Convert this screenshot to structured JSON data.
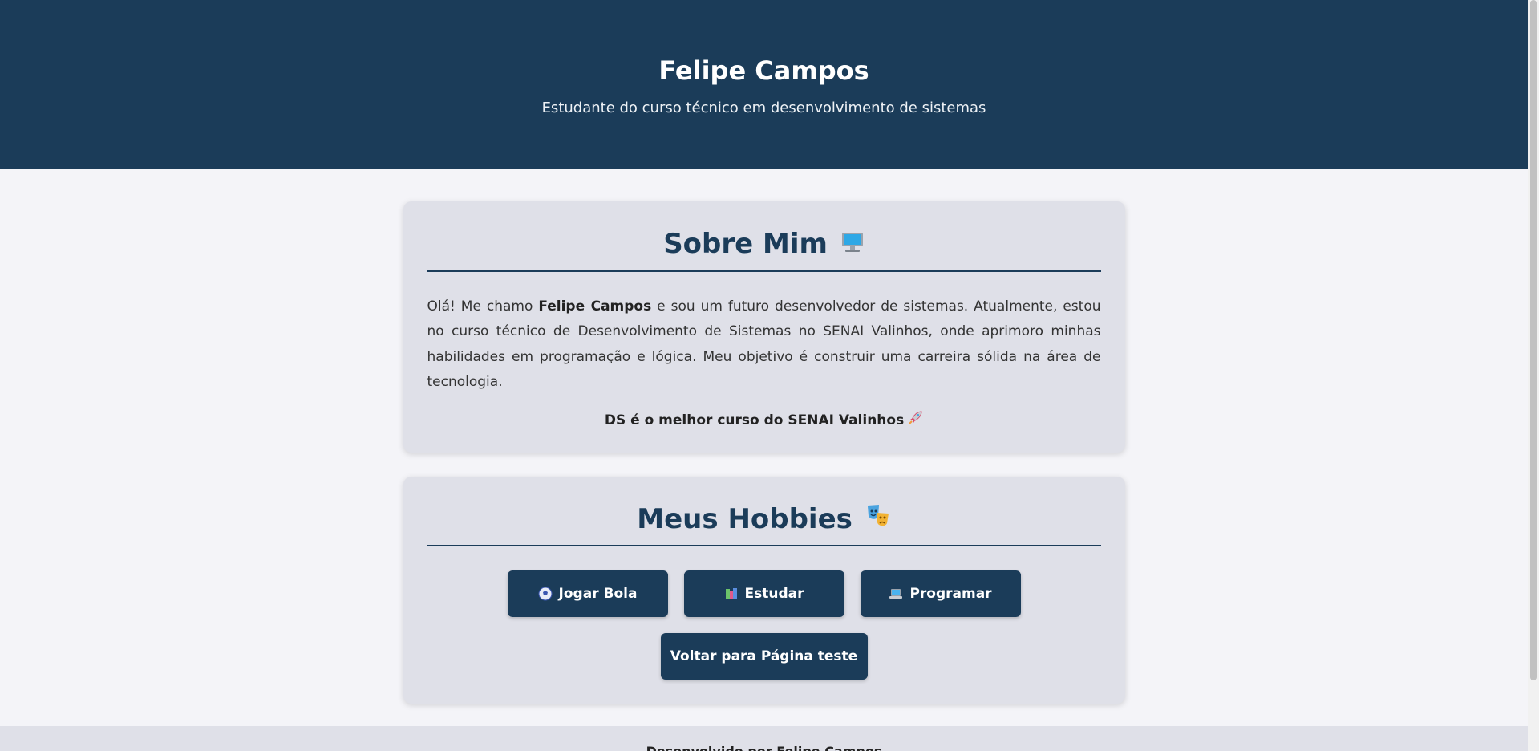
{
  "header": {
    "name": "Felipe Campos",
    "subtitle": "Estudante do curso técnico em desenvolvimento de sistemas"
  },
  "about": {
    "title": "Sobre Mim",
    "title_icon": "computer-monitor-icon",
    "text_before": "Olá! Me chamo ",
    "text_bold": "Felipe Campos",
    "text_after": " e sou um futuro desenvolvedor de sistemas. Atualmente, estou no curso técnico de Desenvolvimento de Sistemas no SENAI Valinhos, onde aprimoro minhas habilidades em programação e lógica. Meu objetivo é construir uma carreira sólida na área de tecnologia.",
    "highlight": "DS é o melhor curso do SENAI Valinhos",
    "highlight_icon": "rocket-icon"
  },
  "hobbies": {
    "title": "Meus Hobbies",
    "title_icon": "theater-masks-icon",
    "items": [
      {
        "label": "Jogar Bola",
        "icon": "soccer-ball-icon"
      },
      {
        "label": "Estudar",
        "icon": "books-icon"
      },
      {
        "label": "Programar",
        "icon": "laptop-icon"
      }
    ],
    "back_label": "Voltar para Página teste"
  },
  "footer": {
    "text": "Desenvolvido por Felipe Campos"
  },
  "colors": {
    "primary": "#1b3c59",
    "card_bg": "#dfe0e8",
    "page_bg": "#f4f4f8"
  }
}
